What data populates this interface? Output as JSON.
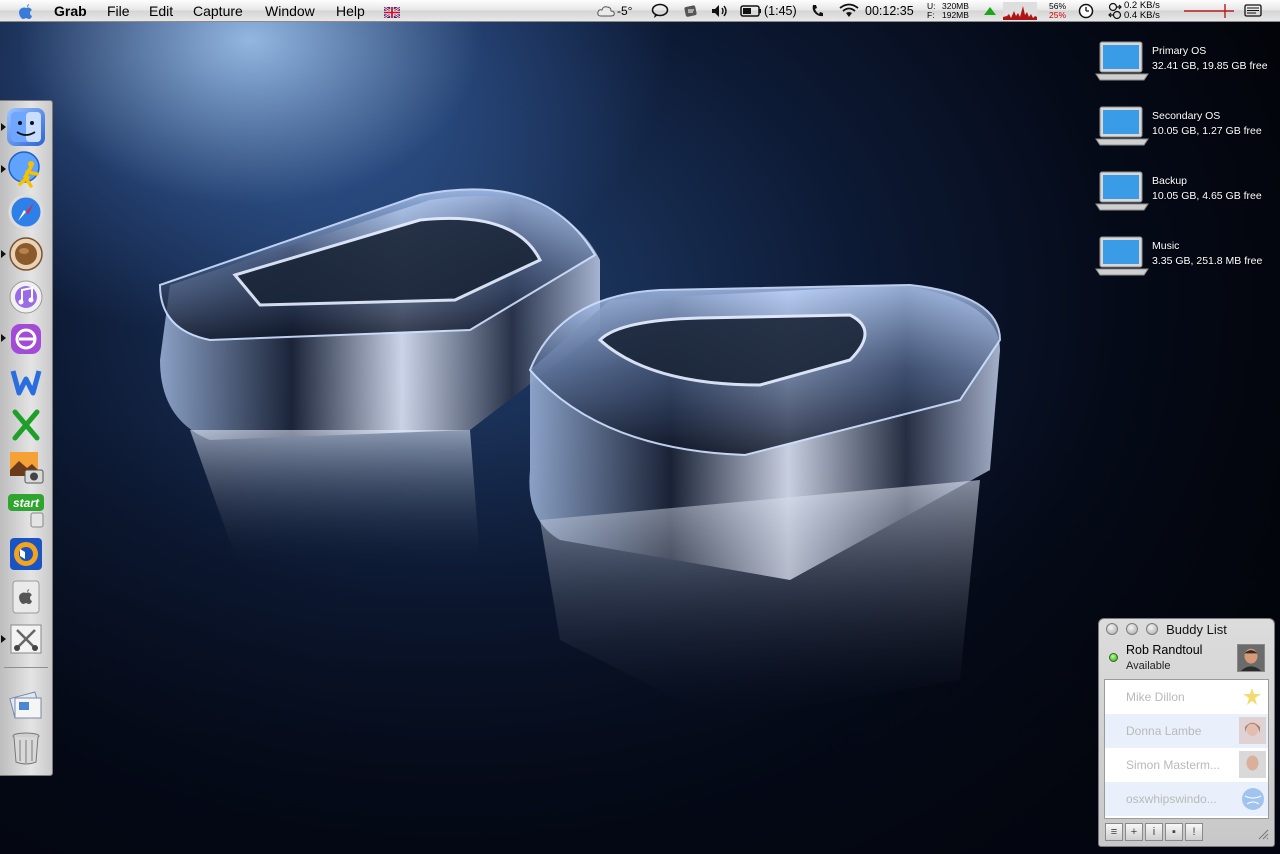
{
  "menubar": {
    "app_name": "Grab",
    "menus": [
      "File",
      "Edit",
      "Capture",
      "Window",
      "Help"
    ],
    "status": {
      "weather_temp": "-5°",
      "battery_time": "(1:45)",
      "clock": "00:12:35",
      "memory_labels": [
        "U:",
        "F:"
      ],
      "memory_values": [
        "320MB",
        "192MB"
      ],
      "cpu_percent": [
        "56%",
        "25%"
      ],
      "net_up": "0.2 KB/s",
      "net_down": "0.4 KB/s"
    }
  },
  "dock": {
    "items": [
      "finder-icon",
      "aim-icon",
      "safari-icon",
      "coffee-icon",
      "itunes-icon",
      "messenger-icon",
      "word-icon",
      "excel-icon",
      "iphoto-icon",
      "start-icon",
      "audio-icon",
      "apple-utility-icon",
      "script-editor-icon",
      "documents-icon",
      "trash-icon"
    ]
  },
  "drives": [
    {
      "name": "Primary OS",
      "info": "32.41 GB, 19.85 GB free"
    },
    {
      "name": "Secondary OS",
      "info": "10.05 GB, 1.27 GB free"
    },
    {
      "name": "Backup",
      "info": "10.05 GB, 4.65 GB free"
    },
    {
      "name": "Music",
      "info": "3.35 GB, 251.8 MB free"
    }
  ],
  "buddy_list": {
    "title": "Buddy List",
    "me": {
      "name": "Rob Randtoul",
      "status": "Available"
    },
    "buddies": [
      {
        "name": "Mike Dillon"
      },
      {
        "name": "Donna Lambe"
      },
      {
        "name": "Simon Masterm..."
      },
      {
        "name": "osxwhipswindo..."
      }
    ]
  }
}
